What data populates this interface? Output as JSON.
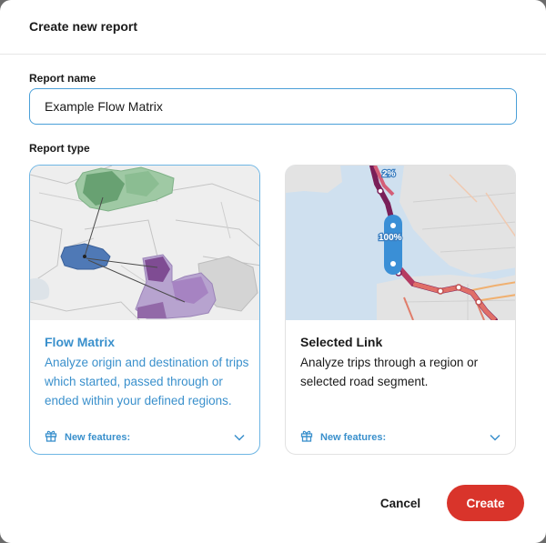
{
  "modal": {
    "title": "Create new report"
  },
  "form": {
    "report_name_label": "Report name",
    "report_name_value": "Example Flow Matrix",
    "report_type_label": "Report type"
  },
  "report_types": [
    {
      "title": "Flow Matrix",
      "description": "Analyze origin and destination of trips which started, passed through or ended within your defined regions.",
      "features_label": "New features:",
      "selected": true
    },
    {
      "title": "Selected Link",
      "description": "Analyze trips through a region or selected road segment.",
      "features_label": "New features:",
      "selected": false,
      "map_labels": {
        "top_percent": "2%",
        "main_percent": "100%"
      }
    }
  ],
  "actions": {
    "cancel_label": "Cancel",
    "create_label": "Create"
  },
  "colors": {
    "accent": "#3a90cc",
    "primary_button": "#d9342b",
    "input_border": "#4a9fd8"
  }
}
